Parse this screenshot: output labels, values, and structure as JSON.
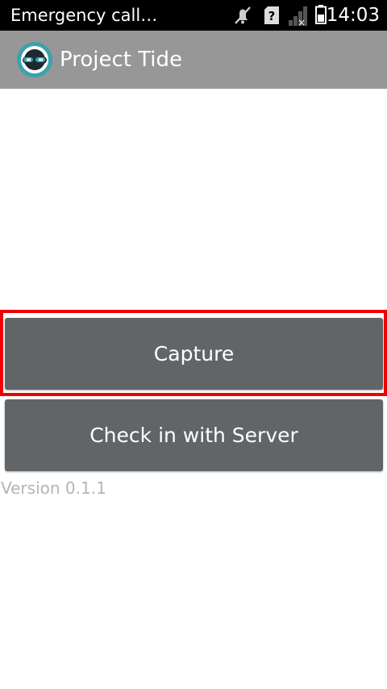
{
  "status_bar": {
    "carrier_text": "Emergency call…",
    "time": "14:03",
    "icons": [
      "muted-icon",
      "sim-unknown-icon",
      "signal-none-icon",
      "battery-icon"
    ]
  },
  "action_bar": {
    "title": "Project Tide",
    "icon": "project-tide-app-icon"
  },
  "main": {
    "capture_label": "Capture",
    "checkin_label": "Check in with Server",
    "version_text": "Version 0.1.1"
  },
  "colors": {
    "status_bar_bg": "#000000",
    "action_bar_bg": "#979797",
    "button_bg": "#616567",
    "highlight": "#ee0000",
    "version_text": "#b4b4b4"
  }
}
